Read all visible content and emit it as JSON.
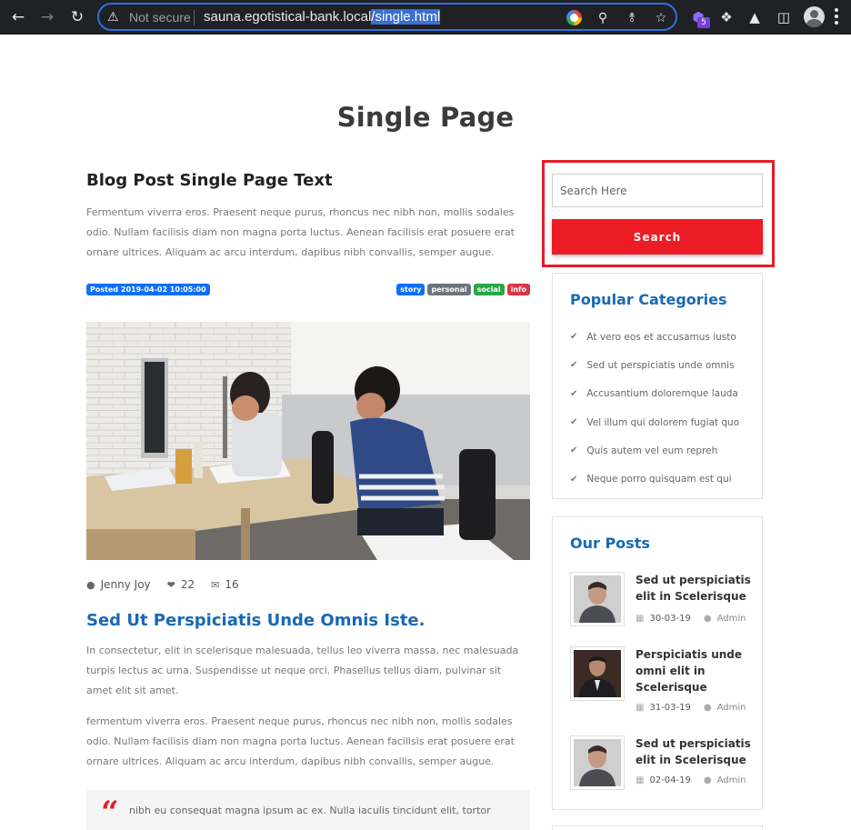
{
  "browser": {
    "security_label": "Not secure",
    "url_host": "sauna.egotistical-bank.local",
    "url_path": "/single.html",
    "extension_badge": "5"
  },
  "page": {
    "title": "Single Page"
  },
  "post": {
    "heading": "Blog Post Single Page Text",
    "intro": "Fermentum viverra eros. Praesent neque purus, rhoncus nec nibh non, mollis sodales odio. Nullam facilisis diam non magna porta luctus. Aenean facilisis erat posuere erat ornare ultrices. Aliquam ac arcu interdum, dapibus nibh convallis, semper augue.",
    "posted": "Posted 2019-04-02 10:05:00",
    "tags": [
      {
        "label": "story",
        "color": "#0d6efd"
      },
      {
        "label": "personal",
        "color": "#6c757d"
      },
      {
        "label": "social",
        "color": "#28a745"
      },
      {
        "label": "info",
        "color": "#dc3545"
      }
    ],
    "author": "Jenny Joy",
    "likes": "22",
    "comments": "16",
    "subheading": "Sed Ut Perspiciatis Unde Omnis Iste.",
    "para2": "In consectetur, elit in scelerisque malesuada, tellus leo viverra massa, nec malesuada turpis lectus ac urna. Suspendisse ut neque orci. Phasellus tellus diam, pulvinar sit amet elit sit amet.",
    "para3": "fermentum viverra eros. Praesent neque purus, rhoncus nec nibh non, mollis sodales odio. Nullam facilisis diam non magna porta luctus. Aenean facilisis erat posuere erat ornare ultrices. Aliquam ac arcu interdum, dapibus nibh convallis, semper augue.",
    "quote": "nibh eu consequat magna ipsum ac ex. Nulla iaculis tincidunt elit, tortor"
  },
  "sidebar": {
    "search_placeholder": "Search Here",
    "search_button": "Search",
    "categories_title": "Popular Categories",
    "categories": [
      "At vero eos et accusamus iusto",
      "Sed ut perspiciatis unde omnis",
      "Accusantium doloremque lauda",
      "Vel illum qui dolorem fugiat quo",
      "Quis autem vel eum repreh",
      "Neque porro quisquam est qui"
    ],
    "posts_title": "Our Posts",
    "posts": [
      {
        "title": "Sed ut perspiciatis elit in Scelerisque",
        "date": "30-03-19",
        "author": "Admin"
      },
      {
        "title": "Perspiciatis unde omni elit in Scelerisque",
        "date": "31-03-19",
        "author": "Admin"
      },
      {
        "title": "Sed ut perspiciatis elit in Scelerisque",
        "date": "02-04-19",
        "author": "Admin"
      }
    ]
  },
  "colors": {
    "accent_blue": "#1769b5",
    "search_red": "#ec1c24",
    "highlight_red": "#e41d26"
  },
  "icons": {
    "back": "arrow-left-icon",
    "forward": "arrow-right-icon",
    "reload": "reload-icon",
    "warning": "warning-icon",
    "check": "check-icon",
    "user": "user-icon",
    "heart": "heart-icon",
    "comment": "comments-icon",
    "calendar": "calendar-icon"
  }
}
